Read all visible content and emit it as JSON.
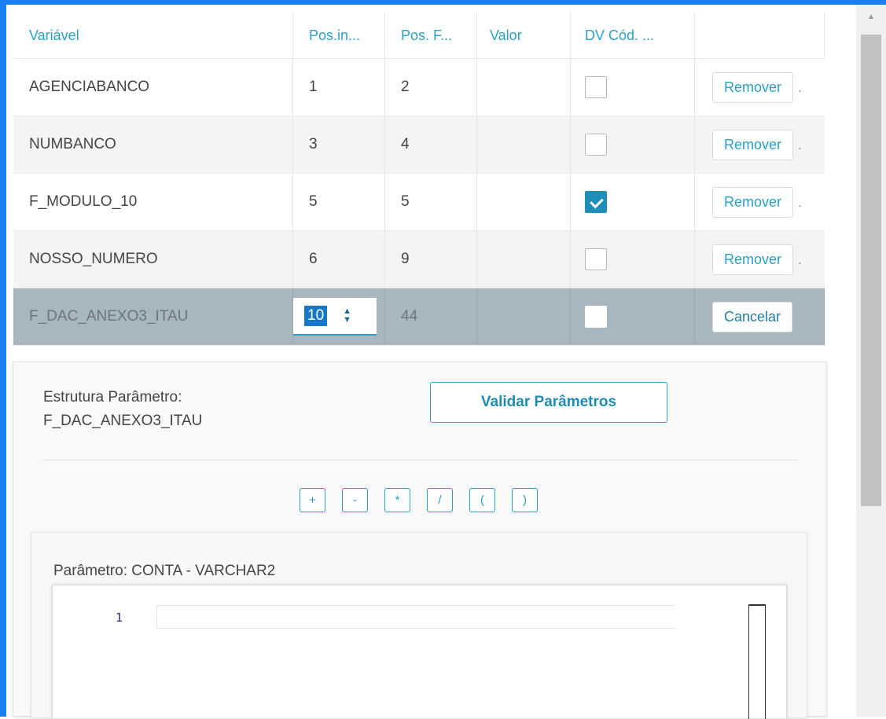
{
  "table": {
    "headers": [
      "Variável",
      "Pos.in...",
      "Pos. F...",
      "Valor",
      "DV Cód. ..."
    ],
    "rows": [
      {
        "variavel": "AGENCIABANCO",
        "pos_ini": "1",
        "pos_fim": "2",
        "valor": "",
        "dv": false,
        "action": "Remover"
      },
      {
        "variavel": "NUMBANCO",
        "pos_ini": "3",
        "pos_fim": "4",
        "valor": "",
        "dv": false,
        "action": "Remover"
      },
      {
        "variavel": "F_MODULO_10",
        "pos_ini": "5",
        "pos_fim": "5",
        "valor": "",
        "dv": true,
        "action": "Remover"
      },
      {
        "variavel": "NOSSO_NUMERO",
        "pos_ini": "6",
        "pos_fim": "9",
        "valor": "",
        "dv": false,
        "action": "Remover"
      }
    ],
    "edit_row": {
      "variavel": "F_DAC_ANEXO3_ITAU",
      "pos_ini": "10",
      "pos_fim": "44",
      "valor": "",
      "dv": false,
      "action": "Cancelar"
    },
    "overflow_marker": "."
  },
  "panel": {
    "estrutura_label": "Estrutura Parâmetro:",
    "estrutura_value": "F_DAC_ANEXO3_ITAU",
    "validate_label": "Validar Parâmetros",
    "operators": [
      "+",
      "-",
      "*",
      "/",
      "(",
      ")"
    ],
    "param_title": "Parâmetro: CONTA - VARCHAR2",
    "editor": {
      "line_number": "1",
      "content": ""
    }
  },
  "colors": {
    "accent": "#2aa0c4",
    "frame": "#1a7ff0",
    "edit_row_bg": "#a8b6c0"
  },
  "icons": {
    "scroll_up": "chevron-up-icon",
    "spinner": "spinner-arrows-icon",
    "check": "checkmark-icon"
  }
}
